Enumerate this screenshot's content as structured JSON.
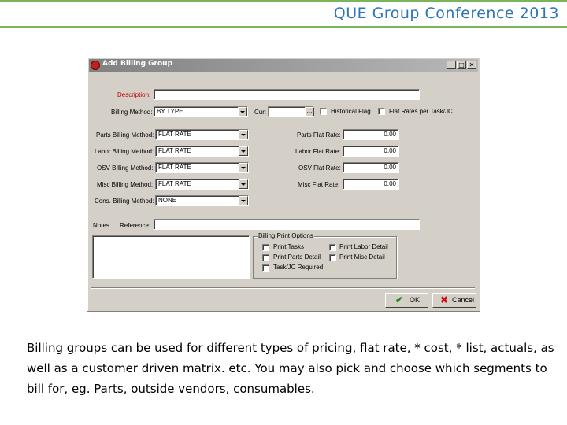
{
  "slide": {
    "header_title": "QUE Group Conference 2013",
    "accent_color": "#7ab55c",
    "title_color": "#2e75b6"
  },
  "window": {
    "title": "Add Billing Group",
    "icon": "app-red-circle-icon",
    "controls": {
      "minimize": "_",
      "maximize": "□",
      "close": "✕"
    }
  },
  "form": {
    "description": {
      "label": "Description:",
      "value": ""
    },
    "billing_method": {
      "label": "Billing Method:",
      "value": "BY TYPE"
    },
    "cur": {
      "label": "Cur:",
      "value": "",
      "browse": "..."
    },
    "historical_flag": {
      "label": "Historical Flag",
      "checked": false
    },
    "flat_rates_per_task": {
      "label": "Flat Rates per Task/JC",
      "checked": false
    },
    "rows": [
      {
        "method_label": "Parts Billing Method:",
        "method_value": "FLAT RATE",
        "rate_label": "Parts Flat Rate:",
        "rate_value": "0.00"
      },
      {
        "method_label": "Labor Billing Method:",
        "method_value": "FLAT RATE",
        "rate_label": "Labor Flat Rate:",
        "rate_value": "0.00"
      },
      {
        "method_label": "OSV Billing Method:",
        "method_value": "FLAT RATE",
        "rate_label": "OSV Flat Rate:",
        "rate_value": "0.00"
      },
      {
        "method_label": "Misc Billing Method:",
        "method_value": "FLAT RATE",
        "rate_label": "Misc Flat Rate:",
        "rate_value": "0.00"
      }
    ],
    "cons_billing": {
      "label": "Cons. Billing Method:",
      "value": "NONE"
    },
    "notes_label": "Notes",
    "reference": {
      "label": "Reference:",
      "value": ""
    },
    "print_options": {
      "title": "Billing Print Options",
      "items": [
        {
          "label": "Print Tasks",
          "checked": false
        },
        {
          "label": "Print Labor Detail",
          "checked": false
        },
        {
          "label": "Print Parts Detail",
          "checked": false
        },
        {
          "label": "Print Misc Detail",
          "checked": false
        },
        {
          "label": "Task/JC Required",
          "checked": false
        }
      ]
    },
    "buttons": {
      "ok": "OK",
      "cancel": "Cancel",
      "ok_icon": "checkmark-icon",
      "cancel_icon": "x-icon"
    }
  },
  "caption": "Billing groups can be used for different types of pricing, flat rate, * cost, * list, actuals, as well as a customer driven matrix. etc. You may also pick and choose which segments to bill for, eg. Parts, outside vendors, consumables."
}
